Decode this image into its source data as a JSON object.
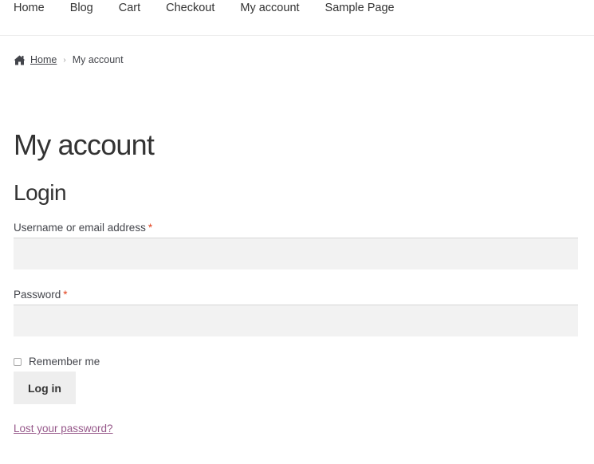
{
  "nav": {
    "items": [
      {
        "label": "Home"
      },
      {
        "label": "Blog"
      },
      {
        "label": "Cart"
      },
      {
        "label": "Checkout"
      },
      {
        "label": "My account"
      },
      {
        "label": "Sample Page"
      }
    ]
  },
  "breadcrumb": {
    "home": "Home",
    "separator": "›",
    "current": "My account"
  },
  "page": {
    "title": "My account",
    "section_title": "Login"
  },
  "form": {
    "username_label": "Username or email address",
    "password_label": "Password",
    "required_mark": "*",
    "username_value": "",
    "password_value": "",
    "remember_label": "Remember me",
    "remember_checked": false,
    "submit_label": "Log in",
    "lost_password": "Lost your password?"
  },
  "colors": {
    "link_accent": "#96588a",
    "required": "#e2401c",
    "input_bg": "#f2f2f2",
    "button_bg": "#eeeeee",
    "text": "#43454b"
  },
  "icons": {
    "breadcrumb_home": "home-icon"
  }
}
